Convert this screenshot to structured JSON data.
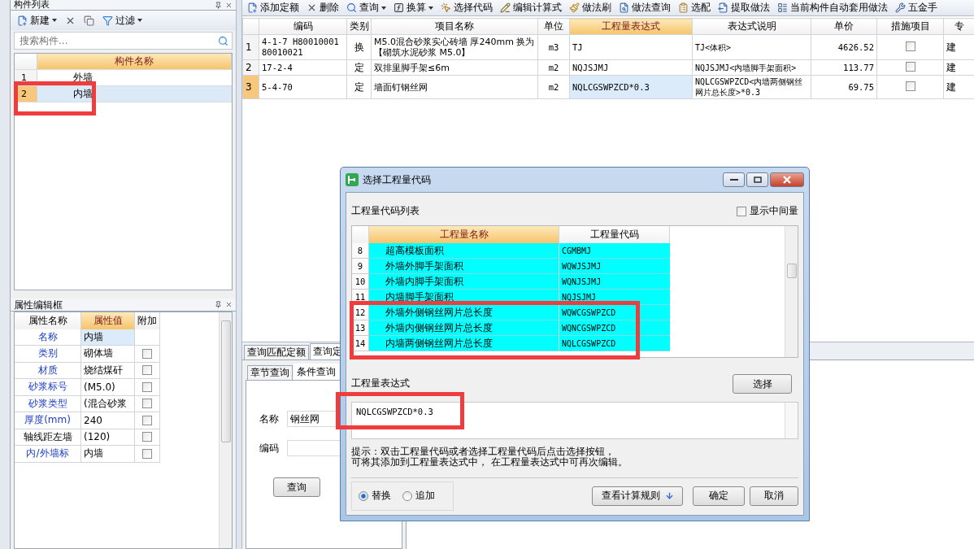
{
  "component_list": {
    "title": "构件列表",
    "toolbar": [
      {
        "kind": "new",
        "label": "新建",
        "dropdown": true
      },
      {
        "kind": "delete"
      },
      {
        "kind": "copy"
      },
      {
        "kind": "filter",
        "label": "过滤",
        "dropdown": true
      }
    ],
    "search": {
      "placeholder": "搜索构件..."
    },
    "column": "构件名称",
    "rows": [
      {
        "num": "1",
        "name": "外墙",
        "selected": false
      },
      {
        "num": "2",
        "name": "内墙",
        "selected": true
      }
    ]
  },
  "properties": {
    "title": "属性编辑框",
    "columns": [
      {
        "label": "属性名称",
        "highlighted": false
      },
      {
        "label": "属性值",
        "highlighted": true
      },
      {
        "label": "附加",
        "highlighted": false
      }
    ],
    "rows": [
      {
        "name": "名称",
        "value": "内墙",
        "highlighted": true,
        "selected": true
      },
      {
        "name": "类别",
        "value": "砌体墙",
        "highlighted": true,
        "selected": false,
        "checked": false
      },
      {
        "name": "材质",
        "value": "烧结煤矸",
        "highlighted": true,
        "selected": false,
        "checked": false
      },
      {
        "name": "砂浆标号",
        "value": "(M5.0)",
        "highlighted": true,
        "selected": false,
        "checked": false
      },
      {
        "name": "砂浆类型",
        "value": "(混合砂浆",
        "highlighted": true,
        "selected": false,
        "checked": false
      },
      {
        "name": "厚度(mm)",
        "value": "240",
        "highlighted": true,
        "selected": false,
        "checked": false
      },
      {
        "name": "轴线距左墙",
        "value": "(120)",
        "highlighted": false,
        "selected": false,
        "checked": false
      },
      {
        "name": "内/外墙标",
        "value": "内墙",
        "highlighted": true,
        "selected": false,
        "checked": false
      }
    ]
  },
  "toolbar": [
    {
      "kind": "add",
      "label": "添加定额"
    },
    {
      "kind": "delete",
      "label": "删除"
    },
    {
      "kind": "search",
      "label": "查询",
      "dropdown": true
    },
    {
      "kind": "formula",
      "label": "换算",
      "dropdown": true
    },
    {
      "kind": "pick",
      "label": "选择代码"
    },
    {
      "kind": "edit",
      "label": "编辑计算式"
    },
    {
      "kind": "brush",
      "label": "做法刷"
    },
    {
      "kind": "find",
      "label": "做法查询"
    },
    {
      "kind": "match",
      "label": "选配"
    },
    {
      "kind": "extract",
      "label": "提取做法"
    },
    {
      "kind": "auto",
      "label": "当前构件自动套用做法"
    },
    {
      "kind": "hardware",
      "label": "五金手"
    }
  ],
  "quota_table": {
    "columns": [
      {
        "label": "编码",
        "highlighted": false
      },
      {
        "label": "类别",
        "highlighted": false
      },
      {
        "label": "项目名称",
        "highlighted": false
      },
      {
        "label": "单位",
        "highlighted": false
      },
      {
        "label": "工程量表达式",
        "highlighted": true
      },
      {
        "label": "表达式说明",
        "highlighted": false
      },
      {
        "label": "单价",
        "highlighted": false
      },
      {
        "label": "措施项目",
        "highlighted": false
      },
      {
        "label": "专",
        "highlighted": false
      }
    ],
    "rows": [
      {
        "num": "1",
        "code": "4-1-7 H80010001 80010021",
        "type": "换",
        "name": "M5.0混合砂浆实心砖墙 厚240mm 换为【砌筑水泥砂浆 M5.0】",
        "unit": "m3",
        "expression": "TJ",
        "description": "TJ<体积>",
        "price": "4626.52",
        "measure": false,
        "column_10": "建",
        "selected": false
      },
      {
        "num": "2",
        "code": "17-2-4",
        "type": "定",
        "name": "双排里脚手架≤6m",
        "unit": "m2",
        "expression": "NQJSJMJ",
        "description": "NQJSJMJ<内墙脚手架面积>",
        "price": "113.77",
        "measure": false,
        "column_10": "建",
        "selected": false
      },
      {
        "num": "3",
        "code": "5-4-70",
        "type": "定",
        "name": "墙面钉钢丝网",
        "unit": "m2",
        "expression": "NQLCGSWPZCD*0.3",
        "description": "NQLCGSWPZCD<内墙两侧钢丝网片总长度>*0.3",
        "price": "69.75",
        "measure": false,
        "column_10": "建",
        "selected": true
      }
    ]
  },
  "query_panel": {
    "tabs": [
      {
        "label": "查询匹配定额",
        "selected": false
      },
      {
        "label": "查询定",
        "selected": true
      }
    ],
    "subtabs": [
      {
        "label": "章节查询",
        "selected": false
      },
      {
        "label": "条件查询",
        "selected": true
      }
    ],
    "fields": [
      {
        "label": "名称",
        "value": "钢丝网"
      },
      {
        "label": "编码"
      }
    ],
    "button": "查询"
  },
  "dialog": {
    "title": "选择工程量代码",
    "list_label": "工程量代码列表",
    "show_intermediate": {
      "label": "显示中间量",
      "checked": false
    },
    "columns": [
      {
        "label": "工程量名称",
        "highlighted": true
      },
      {
        "label": "工程量代码",
        "highlighted": false
      }
    ],
    "rows": [
      {
        "num": "8",
        "name": "超高模板面积",
        "code": "CGMBMJ"
      },
      {
        "num": "9",
        "name": "外墙外脚手架面积",
        "code": "WQWJSJMJ"
      },
      {
        "num": "10",
        "name": "外墙内脚手架面积",
        "code": "WQNJSJMJ"
      },
      {
        "num": "11",
        "name": "内墙脚手架面积",
        "code": "NQJSJMJ"
      },
      {
        "num": "12",
        "name": "外墙外侧钢丝网片总长度",
        "code": "WQWCGSWPZCD"
      },
      {
        "num": "13",
        "name": "外墙内侧钢丝网片总长度",
        "code": "WQNCGSWPZCD"
      },
      {
        "num": "14",
        "name": "内墙两侧钢丝网片总长度",
        "code": "NQLCGSWPZCD"
      }
    ],
    "expression": {
      "label": "工程量表达式",
      "value": "NQLCGSWPZCD*0.3"
    },
    "select_button": "选择",
    "hint": [
      "提示：双击工程量代码或者选择工程量代码后点击选择按钮，",
      "可将其添加到工程量表达式中， 在工程量表达式中可再次编辑。"
    ],
    "modes": [
      {
        "label": "替换",
        "selected": true
      },
      {
        "label": "追加",
        "selected": false
      }
    ],
    "rules_button": "查看计算规则",
    "buttons": [
      "确定",
      "取消"
    ]
  }
}
